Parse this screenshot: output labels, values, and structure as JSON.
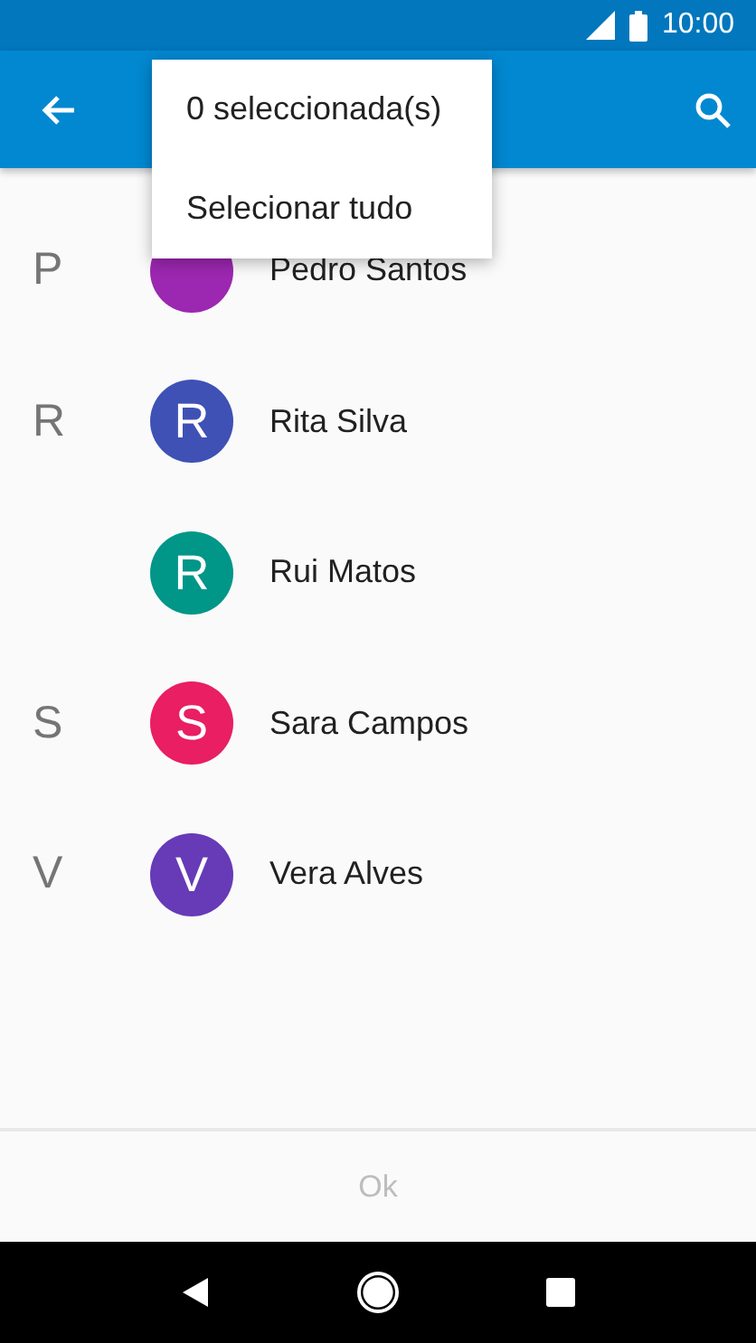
{
  "status_bar": {
    "time": "10:00"
  },
  "menu": {
    "items": [
      {
        "label": "0 seleccionada(s)"
      },
      {
        "label": "Selecionar tudo"
      }
    ]
  },
  "contacts": [
    {
      "section": "P",
      "name": "Pedro Santos",
      "color": "#9c27b0"
    },
    {
      "section": "R",
      "initial": "R",
      "name": "Rita Silva",
      "color": "#3f51b5"
    },
    {
      "initial": "R",
      "name": "Rui Matos",
      "color": "#009688"
    },
    {
      "section": "S",
      "initial": "S",
      "name": "Sara Campos",
      "color": "#e91e63"
    },
    {
      "section": "V",
      "initial": "V",
      "name": "Vera Alves",
      "color": "#673ab7"
    }
  ],
  "ok_button": {
    "label": "Ok",
    "disabled": true
  }
}
